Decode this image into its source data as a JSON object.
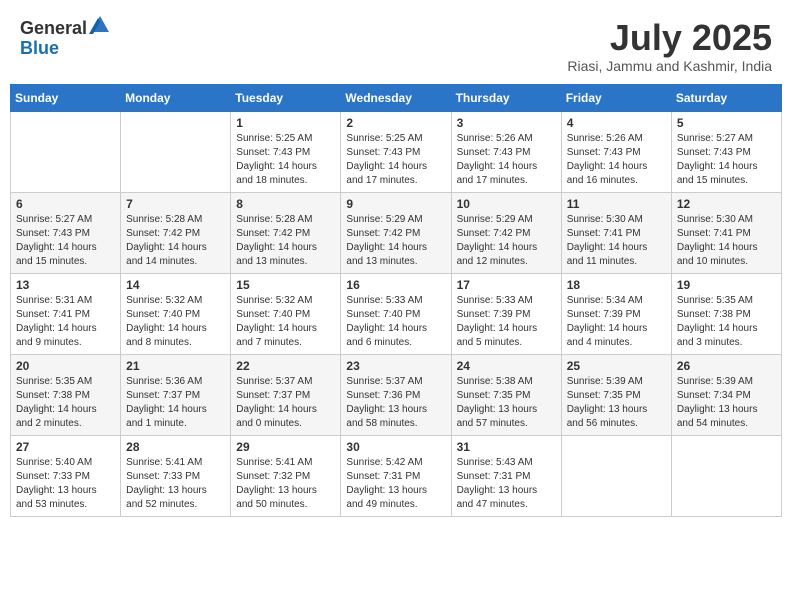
{
  "header": {
    "logo_general": "General",
    "logo_blue": "Blue",
    "month_title": "July 2025",
    "subtitle": "Riasi, Jammu and Kashmir, India"
  },
  "weekdays": [
    "Sunday",
    "Monday",
    "Tuesday",
    "Wednesday",
    "Thursday",
    "Friday",
    "Saturday"
  ],
  "weeks": [
    [
      {
        "day": "",
        "sunrise": "",
        "sunset": "",
        "daylight": ""
      },
      {
        "day": "",
        "sunrise": "",
        "sunset": "",
        "daylight": ""
      },
      {
        "day": "1",
        "sunrise": "Sunrise: 5:25 AM",
        "sunset": "Sunset: 7:43 PM",
        "daylight": "Daylight: 14 hours and 18 minutes."
      },
      {
        "day": "2",
        "sunrise": "Sunrise: 5:25 AM",
        "sunset": "Sunset: 7:43 PM",
        "daylight": "Daylight: 14 hours and 17 minutes."
      },
      {
        "day": "3",
        "sunrise": "Sunrise: 5:26 AM",
        "sunset": "Sunset: 7:43 PM",
        "daylight": "Daylight: 14 hours and 17 minutes."
      },
      {
        "day": "4",
        "sunrise": "Sunrise: 5:26 AM",
        "sunset": "Sunset: 7:43 PM",
        "daylight": "Daylight: 14 hours and 16 minutes."
      },
      {
        "day": "5",
        "sunrise": "Sunrise: 5:27 AM",
        "sunset": "Sunset: 7:43 PM",
        "daylight": "Daylight: 14 hours and 15 minutes."
      }
    ],
    [
      {
        "day": "6",
        "sunrise": "Sunrise: 5:27 AM",
        "sunset": "Sunset: 7:43 PM",
        "daylight": "Daylight: 14 hours and 15 minutes."
      },
      {
        "day": "7",
        "sunrise": "Sunrise: 5:28 AM",
        "sunset": "Sunset: 7:42 PM",
        "daylight": "Daylight: 14 hours and 14 minutes."
      },
      {
        "day": "8",
        "sunrise": "Sunrise: 5:28 AM",
        "sunset": "Sunset: 7:42 PM",
        "daylight": "Daylight: 14 hours and 13 minutes."
      },
      {
        "day": "9",
        "sunrise": "Sunrise: 5:29 AM",
        "sunset": "Sunset: 7:42 PM",
        "daylight": "Daylight: 14 hours and 13 minutes."
      },
      {
        "day": "10",
        "sunrise": "Sunrise: 5:29 AM",
        "sunset": "Sunset: 7:42 PM",
        "daylight": "Daylight: 14 hours and 12 minutes."
      },
      {
        "day": "11",
        "sunrise": "Sunrise: 5:30 AM",
        "sunset": "Sunset: 7:41 PM",
        "daylight": "Daylight: 14 hours and 11 minutes."
      },
      {
        "day": "12",
        "sunrise": "Sunrise: 5:30 AM",
        "sunset": "Sunset: 7:41 PM",
        "daylight": "Daylight: 14 hours and 10 minutes."
      }
    ],
    [
      {
        "day": "13",
        "sunrise": "Sunrise: 5:31 AM",
        "sunset": "Sunset: 7:41 PM",
        "daylight": "Daylight: 14 hours and 9 minutes."
      },
      {
        "day": "14",
        "sunrise": "Sunrise: 5:32 AM",
        "sunset": "Sunset: 7:40 PM",
        "daylight": "Daylight: 14 hours and 8 minutes."
      },
      {
        "day": "15",
        "sunrise": "Sunrise: 5:32 AM",
        "sunset": "Sunset: 7:40 PM",
        "daylight": "Daylight: 14 hours and 7 minutes."
      },
      {
        "day": "16",
        "sunrise": "Sunrise: 5:33 AM",
        "sunset": "Sunset: 7:40 PM",
        "daylight": "Daylight: 14 hours and 6 minutes."
      },
      {
        "day": "17",
        "sunrise": "Sunrise: 5:33 AM",
        "sunset": "Sunset: 7:39 PM",
        "daylight": "Daylight: 14 hours and 5 minutes."
      },
      {
        "day": "18",
        "sunrise": "Sunrise: 5:34 AM",
        "sunset": "Sunset: 7:39 PM",
        "daylight": "Daylight: 14 hours and 4 minutes."
      },
      {
        "day": "19",
        "sunrise": "Sunrise: 5:35 AM",
        "sunset": "Sunset: 7:38 PM",
        "daylight": "Daylight: 14 hours and 3 minutes."
      }
    ],
    [
      {
        "day": "20",
        "sunrise": "Sunrise: 5:35 AM",
        "sunset": "Sunset: 7:38 PM",
        "daylight": "Daylight: 14 hours and 2 minutes."
      },
      {
        "day": "21",
        "sunrise": "Sunrise: 5:36 AM",
        "sunset": "Sunset: 7:37 PM",
        "daylight": "Daylight: 14 hours and 1 minute."
      },
      {
        "day": "22",
        "sunrise": "Sunrise: 5:37 AM",
        "sunset": "Sunset: 7:37 PM",
        "daylight": "Daylight: 14 hours and 0 minutes."
      },
      {
        "day": "23",
        "sunrise": "Sunrise: 5:37 AM",
        "sunset": "Sunset: 7:36 PM",
        "daylight": "Daylight: 13 hours and 58 minutes."
      },
      {
        "day": "24",
        "sunrise": "Sunrise: 5:38 AM",
        "sunset": "Sunset: 7:35 PM",
        "daylight": "Daylight: 13 hours and 57 minutes."
      },
      {
        "day": "25",
        "sunrise": "Sunrise: 5:39 AM",
        "sunset": "Sunset: 7:35 PM",
        "daylight": "Daylight: 13 hours and 56 minutes."
      },
      {
        "day": "26",
        "sunrise": "Sunrise: 5:39 AM",
        "sunset": "Sunset: 7:34 PM",
        "daylight": "Daylight: 13 hours and 54 minutes."
      }
    ],
    [
      {
        "day": "27",
        "sunrise": "Sunrise: 5:40 AM",
        "sunset": "Sunset: 7:33 PM",
        "daylight": "Daylight: 13 hours and 53 minutes."
      },
      {
        "day": "28",
        "sunrise": "Sunrise: 5:41 AM",
        "sunset": "Sunset: 7:33 PM",
        "daylight": "Daylight: 13 hours and 52 minutes."
      },
      {
        "day": "29",
        "sunrise": "Sunrise: 5:41 AM",
        "sunset": "Sunset: 7:32 PM",
        "daylight": "Daylight: 13 hours and 50 minutes."
      },
      {
        "day": "30",
        "sunrise": "Sunrise: 5:42 AM",
        "sunset": "Sunset: 7:31 PM",
        "daylight": "Daylight: 13 hours and 49 minutes."
      },
      {
        "day": "31",
        "sunrise": "Sunrise: 5:43 AM",
        "sunset": "Sunset: 7:31 PM",
        "daylight": "Daylight: 13 hours and 47 minutes."
      },
      {
        "day": "",
        "sunrise": "",
        "sunset": "",
        "daylight": ""
      },
      {
        "day": "",
        "sunrise": "",
        "sunset": "",
        "daylight": ""
      }
    ]
  ]
}
